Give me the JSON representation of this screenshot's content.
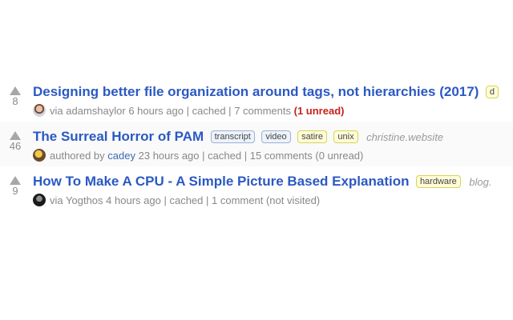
{
  "stories": [
    {
      "score": "8",
      "title": "Designing better file organization around tags, not hierarchies (2017)",
      "tags": [
        "d"
      ],
      "domain": "",
      "avatar": "avatar-icon",
      "via": "via",
      "user": "adamshaylor",
      "time": "6 hours ago",
      "sep": "|",
      "cached": "cached",
      "comments": "7 comments",
      "unread": "(1 unread)"
    },
    {
      "score": "46",
      "title": "The Surreal Horror of PAM",
      "tags": [
        "transcript",
        "video",
        "satire",
        "unix"
      ],
      "domain": "christine.website",
      "avatar": "avatar-icon",
      "via": "authored by",
      "user": "cadey",
      "time": "23 hours ago",
      "sep": "|",
      "cached": "cached",
      "comments": "15 comments (0 unread)",
      "unread": ""
    },
    {
      "score": "9",
      "title": "How To Make A CPU - A Simple Picture Based Explanation",
      "tags": [
        "hardware"
      ],
      "domain": "blog.",
      "avatar": "avatar-icon",
      "via": "via",
      "user": "Yogthos",
      "time": "4 hours ago",
      "sep": "|",
      "cached": "cached",
      "comments": "1 comment (not visited)",
      "unread": ""
    }
  ],
  "colors": {
    "title": "#2b59c3",
    "meta": "#888888",
    "unread": "#c4241b",
    "tag_blue_bg": "#eef3fb",
    "tag_yellow_bg": "#fffcd7"
  }
}
